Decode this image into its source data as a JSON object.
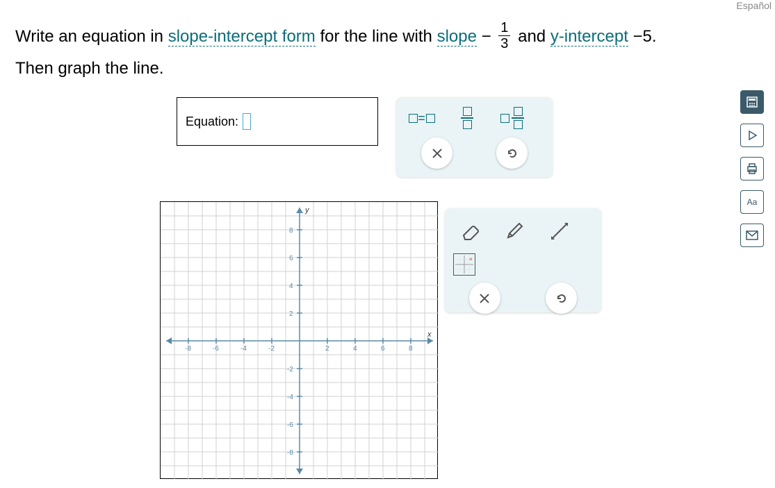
{
  "language_label": "Español",
  "question": {
    "part1": "Write an equation in ",
    "term1": "slope-intercept form",
    "part2": " for the line with ",
    "term2": "slope",
    "part3_prefix": " −",
    "fraction": {
      "num": "1",
      "den": "3"
    },
    "part3_mid": " and ",
    "term3": "y-intercept",
    "part3_suffix": " −5.",
    "line2": "Then graph the line."
  },
  "equation_label": "Equation:",
  "toolbox1": {
    "eq_template": "□=□",
    "frac_template": "□/□",
    "mixed_template": "□ □/□",
    "clear": "×",
    "undo": "↺"
  },
  "toolbox2": {
    "eraser": "eraser",
    "pencil": "pencil",
    "line_tool": "line",
    "grid_reset": "grid",
    "clear": "×",
    "undo": "↺"
  },
  "graph": {
    "x_label": "x",
    "y_label": "y",
    "ticks": [
      "-8",
      "-6",
      "-4",
      "-2",
      "2",
      "4",
      "6",
      "8"
    ]
  },
  "sidebar": {
    "calculator": "calc",
    "video": "video",
    "print": "print",
    "text": "Aa",
    "message": "msg"
  },
  "chart_data": {
    "type": "scatter",
    "title": "",
    "xlabel": "x",
    "ylabel": "y",
    "xlim": [
      -9,
      9
    ],
    "ylim": [
      -9,
      9
    ],
    "x_ticks": [
      -8,
      -6,
      -4,
      -2,
      2,
      4,
      6,
      8
    ],
    "y_ticks": [
      -8,
      -6,
      -4,
      -2,
      2,
      4,
      6,
      8
    ],
    "series": []
  }
}
